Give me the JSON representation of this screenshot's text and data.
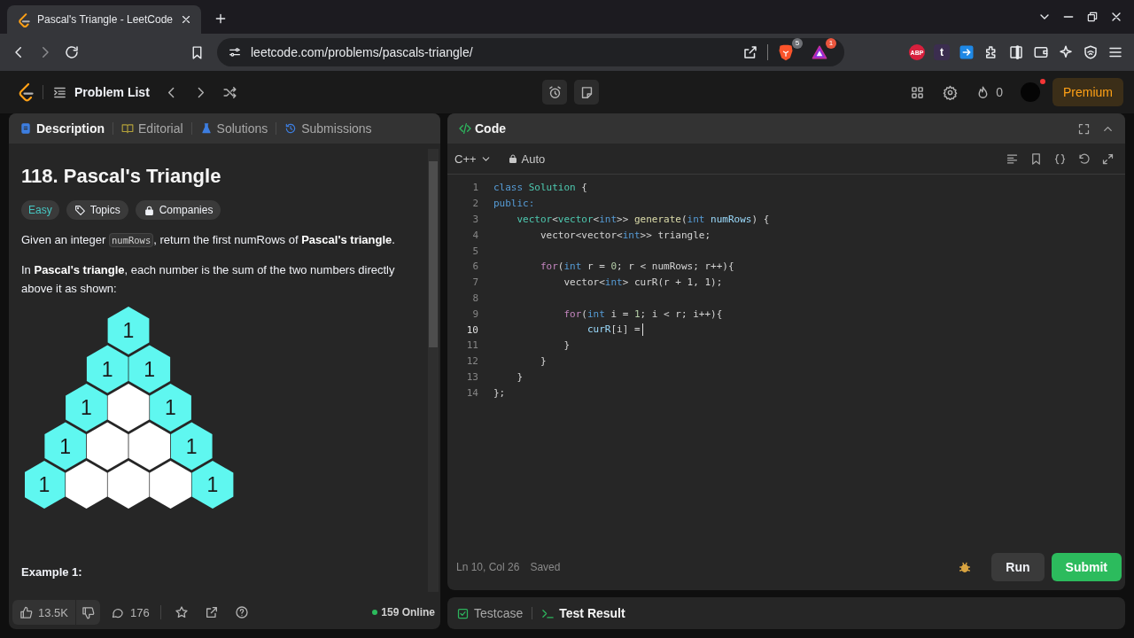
{
  "browser": {
    "tab_title": "Pascal's Triangle - LeetCode",
    "url": "leetcode.com/problems/pascals-triangle/",
    "shields_badge": "5",
    "rewards_badge": "1",
    "extensions": [
      {
        "label": "ABP",
        "kind": "adblock"
      },
      {
        "label": "t",
        "kind": "letter"
      }
    ]
  },
  "nav": {
    "problem_list": "Problem List",
    "streak": "0",
    "premium": "Premium"
  },
  "description_tabs": [
    {
      "label": "Description",
      "kind": "description",
      "selected": true
    },
    {
      "label": "Editorial",
      "kind": "editorial",
      "selected": false
    },
    {
      "label": "Solutions",
      "kind": "solutions",
      "selected": false
    },
    {
      "label": "Submissions",
      "kind": "submissions",
      "selected": false
    }
  ],
  "problem": {
    "title": "118. Pascal's Triangle",
    "difficulty": "Easy",
    "tags": [
      {
        "label": "Topics",
        "kind": "topics"
      },
      {
        "label": "Companies",
        "kind": "companies"
      }
    ],
    "paragraphs": [
      [
        {
          "kind": "text",
          "text": "Given an integer "
        },
        {
          "kind": "code",
          "text": "numRows"
        },
        {
          "kind": "text",
          "text": ", return the first numRows of **Pascal's triangle**."
        }
      ],
      [
        {
          "kind": "text",
          "text": "In **Pascal's triangle**, each number is the sum of the two numbers directly above it as shown:"
        }
      ]
    ],
    "figure_rows": [
      [
        {
          "kind": "edge",
          "value": "1"
        }
      ],
      [
        {
          "kind": "edge",
          "value": "1"
        },
        {
          "kind": "edge",
          "value": "1"
        }
      ],
      [
        {
          "kind": "edge",
          "value": "1"
        },
        {
          "kind": "inner"
        },
        {
          "kind": "edge",
          "value": "1"
        }
      ],
      [
        {
          "kind": "edge",
          "value": "1"
        },
        {
          "kind": "inner"
        },
        {
          "kind": "inner"
        },
        {
          "kind": "edge",
          "value": "1"
        }
      ],
      [
        {
          "kind": "edge",
          "value": "1"
        },
        {
          "kind": "inner"
        },
        {
          "kind": "inner"
        },
        {
          "kind": "inner"
        },
        {
          "kind": "edge",
          "value": "1"
        }
      ]
    ],
    "example_heading": "Example 1:"
  },
  "footer": {
    "likes": "13.5K",
    "comments": "176",
    "online": "159 Online"
  },
  "code_panel": {
    "title": "Code",
    "language": "C++",
    "mode": "Auto",
    "lines": [
      {
        "number": "1",
        "current": false,
        "tokens": [
          {
            "text": "class",
            "kind": "keyword"
          },
          {
            "text": " Solution",
            "kind": "type"
          },
          {
            "text": " {",
            "kind": "plain"
          }
        ]
      },
      {
        "number": "2",
        "current": false,
        "tokens": [
          {
            "text": "public:",
            "kind": "keyword"
          }
        ]
      },
      {
        "number": "3",
        "current": false,
        "tokens": [
          {
            "text": "    vector",
            "kind": "type"
          },
          {
            "text": "<",
            "kind": "plain"
          },
          {
            "text": "vector",
            "kind": "type"
          },
          {
            "text": "<",
            "kind": "plain"
          },
          {
            "text": "int",
            "kind": "keyword"
          },
          {
            "text": ">> ",
            "kind": "plain"
          },
          {
            "text": "generate",
            "kind": "function"
          },
          {
            "text": "(",
            "kind": "plain"
          },
          {
            "text": "int",
            "kind": "keyword"
          },
          {
            "text": " numRows",
            "kind": "variable"
          },
          {
            "text": ") {",
            "kind": "plain"
          }
        ]
      },
      {
        "number": "4",
        "current": false,
        "tokens": [
          {
            "text": "        vector<vector<",
            "kind": "plain"
          },
          {
            "text": "int",
            "kind": "keyword"
          },
          {
            "text": ">> triangle;",
            "kind": "plain"
          }
        ]
      },
      {
        "number": "5",
        "current": false
      },
      {
        "number": "6",
        "current": false,
        "tokens": [
          {
            "text": "        for",
            "kind": "control"
          },
          {
            "text": "(",
            "kind": "plain"
          },
          {
            "text": "int",
            "kind": "keyword"
          },
          {
            "text": " r = ",
            "kind": "plain"
          },
          {
            "text": "0",
            "kind": "number"
          },
          {
            "text": "; r < numRows; r++){",
            "kind": "plain"
          }
        ]
      },
      {
        "number": "7",
        "current": false,
        "tokens": [
          {
            "text": "            vector<",
            "kind": "plain"
          },
          {
            "text": "int",
            "kind": "keyword"
          },
          {
            "text": "> curR(r + 1, 1);",
            "kind": "plain"
          }
        ]
      },
      {
        "number": "8",
        "current": false
      },
      {
        "number": "9",
        "current": false,
        "tokens": [
          {
            "text": "            for",
            "kind": "control"
          },
          {
            "text": "(",
            "kind": "plain"
          },
          {
            "text": "int",
            "kind": "keyword"
          },
          {
            "text": " i = ",
            "kind": "plain"
          },
          {
            "text": "1",
            "kind": "number"
          },
          {
            "text": "; i < r; i++){",
            "kind": "plain"
          }
        ]
      },
      {
        "number": "10",
        "current": true,
        "tokens": [
          {
            "text": "                curR",
            "kind": "variable"
          },
          {
            "text": "[i] =",
            "kind": "plain"
          }
        ]
      },
      {
        "number": "11",
        "current": false,
        "tokens": [
          {
            "text": "            }",
            "kind": "plain"
          }
        ]
      },
      {
        "number": "12",
        "current": false,
        "tokens": [
          {
            "text": "        }",
            "kind": "plain"
          }
        ]
      },
      {
        "number": "13",
        "current": false,
        "tokens": [
          {
            "text": "    }",
            "kind": "plain"
          }
        ]
      },
      {
        "number": "14",
        "current": false,
        "tokens": [
          {
            "text": "};",
            "kind": "plain"
          }
        ]
      }
    ],
    "cursor": "Ln 10, Col 26",
    "save_state": "Saved",
    "run": "Run",
    "submit": "Submit"
  },
  "bottom_tabs": [
    {
      "label": "Testcase",
      "kind": "testcase",
      "selected": false
    },
    {
      "label": "Test Result",
      "kind": "result",
      "selected": true
    }
  ]
}
